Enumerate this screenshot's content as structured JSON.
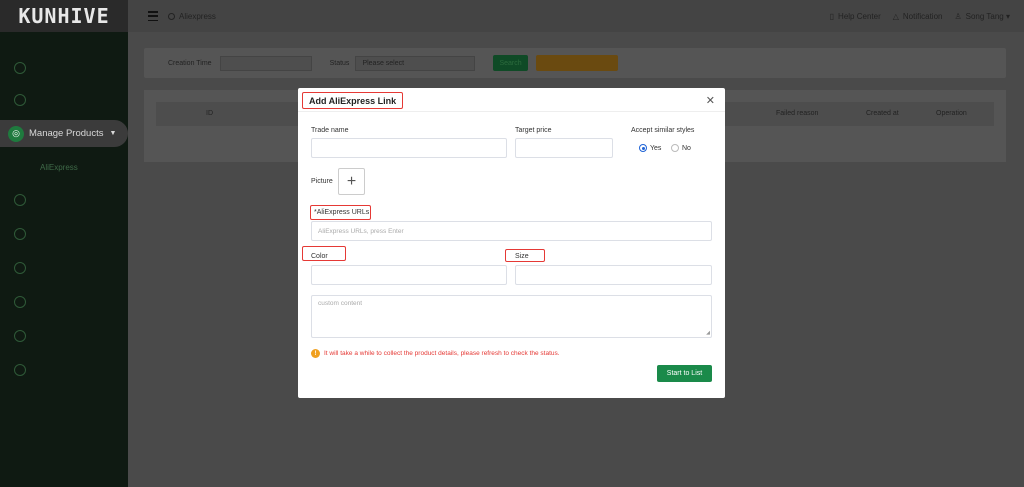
{
  "app": {
    "logo_text": "KUNHIVE"
  },
  "sidebar": {
    "active_label": "Manage Products",
    "sub_label": "AliExpress"
  },
  "topbar": {
    "breadcrumb": "Aliexpress",
    "help": "Help Center",
    "notification": "Notification",
    "user": "Song Tang"
  },
  "filter": {
    "creation_time_label": "Creation Time",
    "status_label": "Status",
    "status_placeholder": "Please select",
    "search_button": "Search",
    "add_button": "Add AliExpress Link"
  },
  "table": {
    "headers": [
      "ID",
      "Failed reason",
      "Created at",
      "Operation"
    ]
  },
  "modal": {
    "title": "Add AliExpress Link",
    "trade_name_label": "Trade name",
    "target_price_label": "Target price",
    "accept_similar_label": "Accept similar styles",
    "radio_yes": "Yes",
    "radio_no": "No",
    "picture_label": "Picture",
    "urls_label": "*AliExpress URLs",
    "urls_placeholder": "AliExpress URLs, press Enter",
    "color_label": "Color",
    "size_label": "Size",
    "custom_placeholder": "custom content",
    "note": "It will take a while to collect the product details, please refresh to check the status.",
    "start_button": "Start to List"
  },
  "colors": {
    "primary_green": "#1a8a4a",
    "highlight_red": "#e53935",
    "radio_blue": "#1f63d6"
  }
}
